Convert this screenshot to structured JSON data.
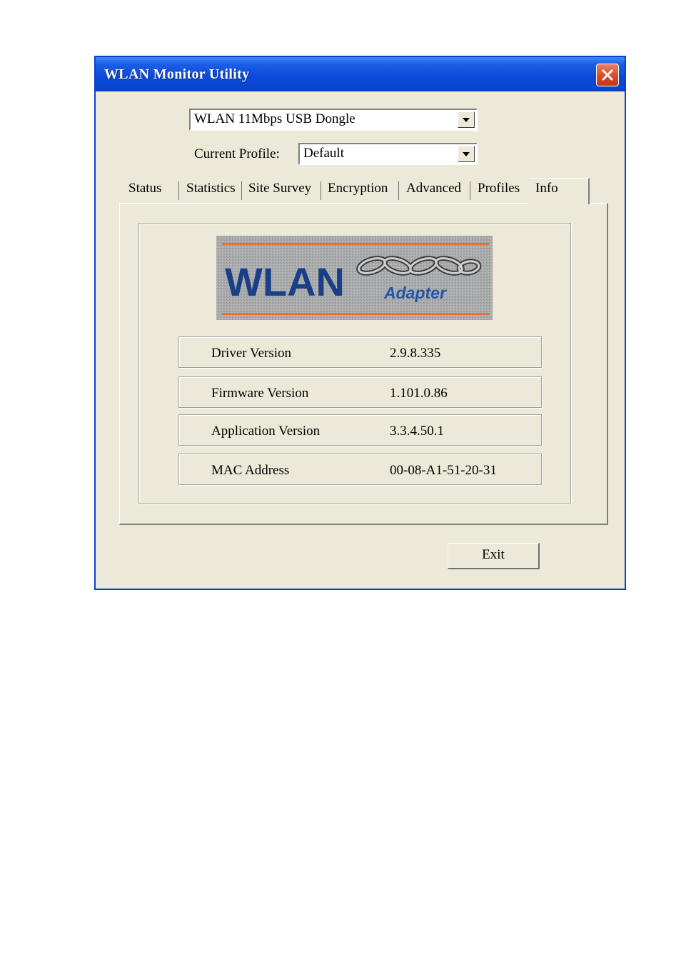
{
  "window": {
    "title": "WLAN Monitor Utility"
  },
  "adapter_select": {
    "value": "WLAN 11Mbps USB Dongle"
  },
  "profile": {
    "label": "Current Profile:",
    "value": "Default"
  },
  "tabs": [
    {
      "label": "Status"
    },
    {
      "label": "Statistics"
    },
    {
      "label": "Site Survey"
    },
    {
      "label": "Encryption"
    },
    {
      "label": "Advanced"
    },
    {
      "label": "Profiles"
    },
    {
      "label": "Info",
      "active": true
    }
  ],
  "logo": {
    "text_main": "WLAN",
    "text_sub": "Adapter",
    "icon": "chain-icon",
    "colors": {
      "text": "#1b3f86",
      "sub_text": "#2256a8",
      "stripe": "#e8742a",
      "background": "#a9aaac"
    }
  },
  "info": {
    "rows": [
      {
        "key": "Driver Version",
        "value": "2.9.8.335"
      },
      {
        "key": "Firmware Version",
        "value": "1.101.0.86"
      },
      {
        "key": "Application Version",
        "value": "3.3.4.50.1"
      },
      {
        "key": "MAC Address",
        "value": "00-08-A1-51-20-31"
      }
    ]
  },
  "buttons": {
    "exit": "Exit"
  },
  "colors": {
    "titlebar": "#0a48d8",
    "window_bg": "#ece9d8",
    "close_button": "#d84a26"
  }
}
